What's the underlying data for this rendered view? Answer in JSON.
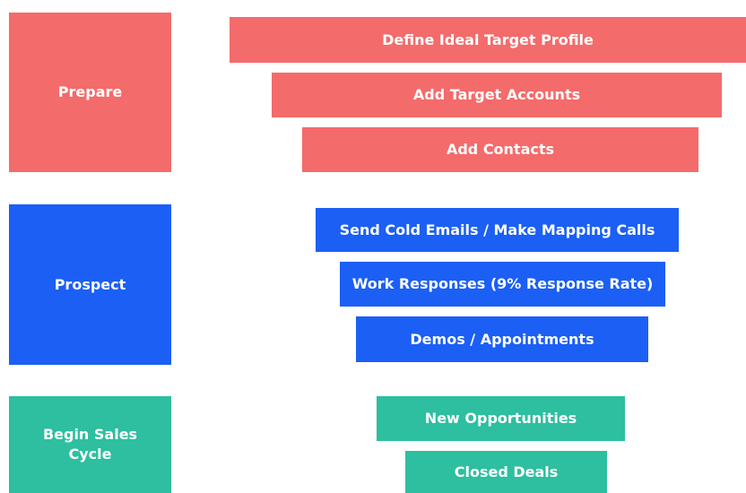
{
  "colors": {
    "prepare": "#f46b6b",
    "prospect": "#1b5ff5",
    "begin_sales_cycle": "#2dbf9f",
    "text": "#ffffff",
    "background": "#ffffff"
  },
  "stages": [
    {
      "label": "Prepare",
      "steps": [
        "Define Ideal Target Profile",
        "Add Target Accounts",
        "Add Contacts"
      ]
    },
    {
      "label": "Prospect",
      "steps": [
        "Send Cold Emails / Make Mapping Calls",
        "Work Responses (9% Response Rate)",
        "Demos / Appointments"
      ]
    },
    {
      "label": "Begin Sales Cycle",
      "steps": [
        "New Opportunities",
        "Closed Deals"
      ]
    }
  ]
}
